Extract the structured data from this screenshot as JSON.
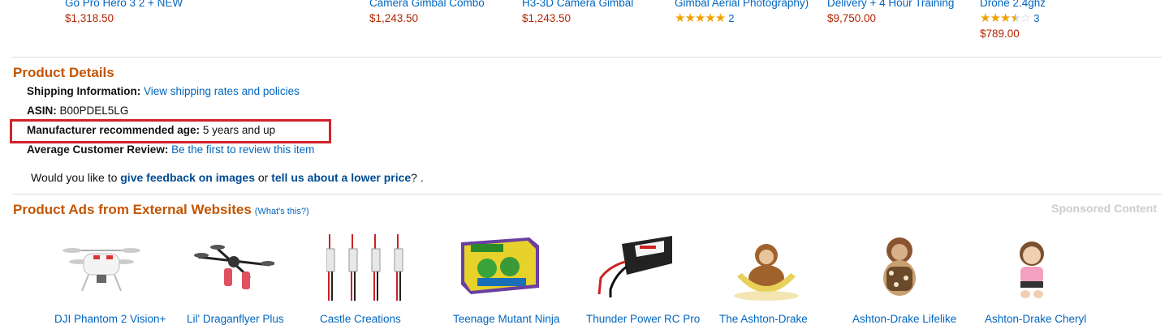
{
  "carousel": [
    {
      "title": "Go Pro Hero 3 2 + NEW",
      "price": "$1,318.50"
    },
    {
      "title": "Camera Gimbal Combo",
      "price": "$1,243.50"
    },
    {
      "title": "H3-3D Camera Gimbal",
      "price": "$1,243.50"
    },
    {
      "title": "Gimbal Aerial Photography)",
      "rating": 5,
      "review_count": "2"
    },
    {
      "title": "Delivery + 4 Hour Training",
      "price": "$9,750.00"
    },
    {
      "title": "Drone 2.4ghz",
      "rating": 3.5,
      "review_count": "3",
      "price": "$789.00"
    }
  ],
  "product_details": {
    "heading": "Product Details",
    "shipping_label": "Shipping Information:",
    "shipping_link": "View shipping rates and policies",
    "asin_label": "ASIN:",
    "asin_value": "B00PDEL5LG",
    "age_label": "Manufacturer recommended age:",
    "age_value": "5 years and up",
    "review_label": "Average Customer Review:",
    "review_link": "Be the first to review this item"
  },
  "feedback": {
    "prefix": "Would you like to",
    "images_link": "give feedback on images",
    "middle": "or",
    "price_link": "tell us about a lower price",
    "suffix": "? ."
  },
  "external_ads": {
    "heading": "Product Ads from External Websites",
    "whats_this": "(What's this?)",
    "sponsored": "Sponsored Content",
    "items": [
      {
        "title": "DJI Phantom 2 Vision+"
      },
      {
        "title": "Lil' Draganflyer Plus"
      },
      {
        "title": "Castle Creations"
      },
      {
        "title": "Teenage Mutant Ninja"
      },
      {
        "title": "Thunder Power RC Pro"
      },
      {
        "title": "The Ashton-Drake"
      },
      {
        "title": "Ashton-Drake Lifelike"
      },
      {
        "title": "Ashton-Drake Cheryl"
      }
    ]
  },
  "colors": {
    "heading_orange": "#c45500",
    "link_blue": "#0066c0",
    "price_red": "#b12704",
    "highlight_red": "#d2222d"
  }
}
